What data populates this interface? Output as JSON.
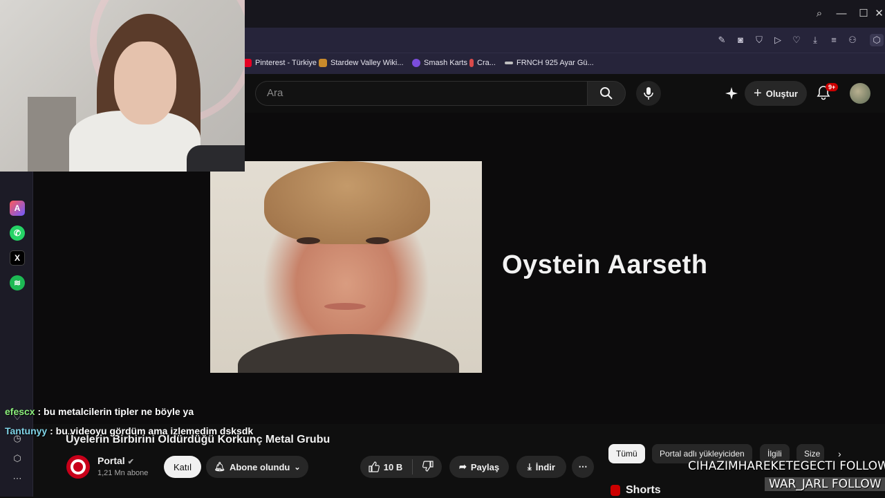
{
  "browser": {
    "window_controls": {
      "search_icon": "⌕",
      "minimize": "—",
      "maximize": "☐",
      "close": "✕"
    },
    "toolbar_icons": [
      "edit-icon",
      "camera-icon",
      "shield-icon",
      "play-icon",
      "heart-icon",
      "download-icon",
      "menu-icon",
      "user-icon",
      "cube-icon"
    ],
    "bookmarks": [
      {
        "label": "Pinterest - Türkiye",
        "color": "#e60023"
      },
      {
        "label": "Stardew Valley Wiki...",
        "color": "#c98a2b"
      },
      {
        "label": "Smash Karts",
        "color": "#7b4ddb"
      },
      {
        "label": "Cra...",
        "color": "#d94a4a"
      },
      {
        "label": "FRNCH 925 Ayar Gü...",
        "color": "#bfbfbf"
      }
    ]
  },
  "youtube": {
    "search_placeholder": "Ara",
    "create_label": "Oluştur",
    "notification_count": "9+"
  },
  "video": {
    "overlay_text": "Oystein Aarseth",
    "title": "Üyelerin Birbirini Öldürdüğü Korkunç Metal Grubu",
    "channel_name": "Portal",
    "subscribers": "1,21 Mn abone",
    "join_label": "Katıl",
    "subscribed_label": "Abone olundu",
    "like_count": "10 B",
    "share_label": "Paylaş",
    "download_label": "İndir"
  },
  "chips": [
    "Tümü",
    "Portal adlı yükleyiciden",
    "İlgili",
    "Size"
  ],
  "shorts_label": "Shorts",
  "chat": [
    {
      "user": "efescx",
      "message": "bu metalcilerin tipler ne böyle ya"
    },
    {
      "user": "Tantunyy",
      "message": "bu videoyu gördüm ama izlemedim dsksdk"
    }
  ],
  "follow_alerts": [
    "CIHAZIMHAREKETEGECTI  FOLLOW",
    "WAR_JARL  FOLLOW"
  ],
  "colors": {
    "accent_red": "#cc0000",
    "chat_user1": "#8cf07c",
    "chat_user2": "#7fd3e6"
  }
}
